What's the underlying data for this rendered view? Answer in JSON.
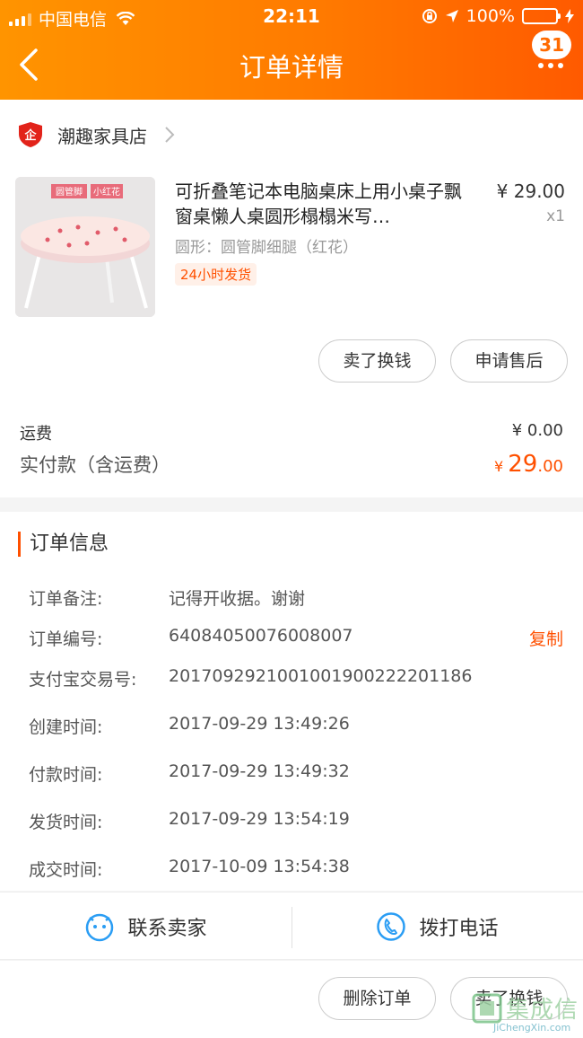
{
  "status_bar": {
    "carrier": "中国电信",
    "time": "22:11",
    "battery": "100%"
  },
  "header": {
    "title": "订单详情",
    "badge_count": "31",
    "colors": {
      "gradient_start": "#ff9400",
      "gradient_end": "#ff5a00"
    }
  },
  "store": {
    "name": "潮趣家具店"
  },
  "product": {
    "title": "可折叠笔记本电脑桌床上用小桌子飘窗桌懒人桌圆形榻榻米写…",
    "price": "¥ 29.00",
    "quantity": "x1",
    "spec": "圆形：圆管脚细腿（红花）",
    "tag": "24小时发货",
    "image_labels": [
      "圆管脚",
      "小红花"
    ]
  },
  "item_actions": {
    "sell_label": "卖了换钱",
    "after_sale_label": "申请售后"
  },
  "fees": {
    "shipping_label": "运费",
    "shipping_value": "¥ 0.00",
    "paid_label": "实付款（含运费）",
    "paid_currency": "¥ ",
    "paid_int": "29",
    "paid_dec": ".00"
  },
  "order_info": {
    "heading": "订单信息",
    "rows": [
      {
        "key": "订单备注:",
        "value": "记得开收据。谢谢"
      },
      {
        "key": "订单编号:",
        "value": "64084050076008007",
        "action": "复制"
      },
      {
        "key": "支付宝交易号:",
        "value": "2017092921001001900222201186"
      },
      {
        "key": "创建时间:",
        "value": "2017-09-29 13:49:26"
      },
      {
        "key": "付款时间:",
        "value": "2017-09-29 13:49:32"
      },
      {
        "key": "发货时间:",
        "value": "2017-09-29 13:54:19"
      },
      {
        "key": "成交时间:",
        "value": "2017-10-09 13:54:38"
      }
    ]
  },
  "contact": {
    "seller_label": "联系卖家",
    "phone_label": "拨打电话"
  },
  "bottom_bar": {
    "delete_label": "删除订单",
    "sell_label": "卖了换钱"
  },
  "watermark": {
    "cn": "集成信",
    "en": "JiChengXin.com"
  }
}
